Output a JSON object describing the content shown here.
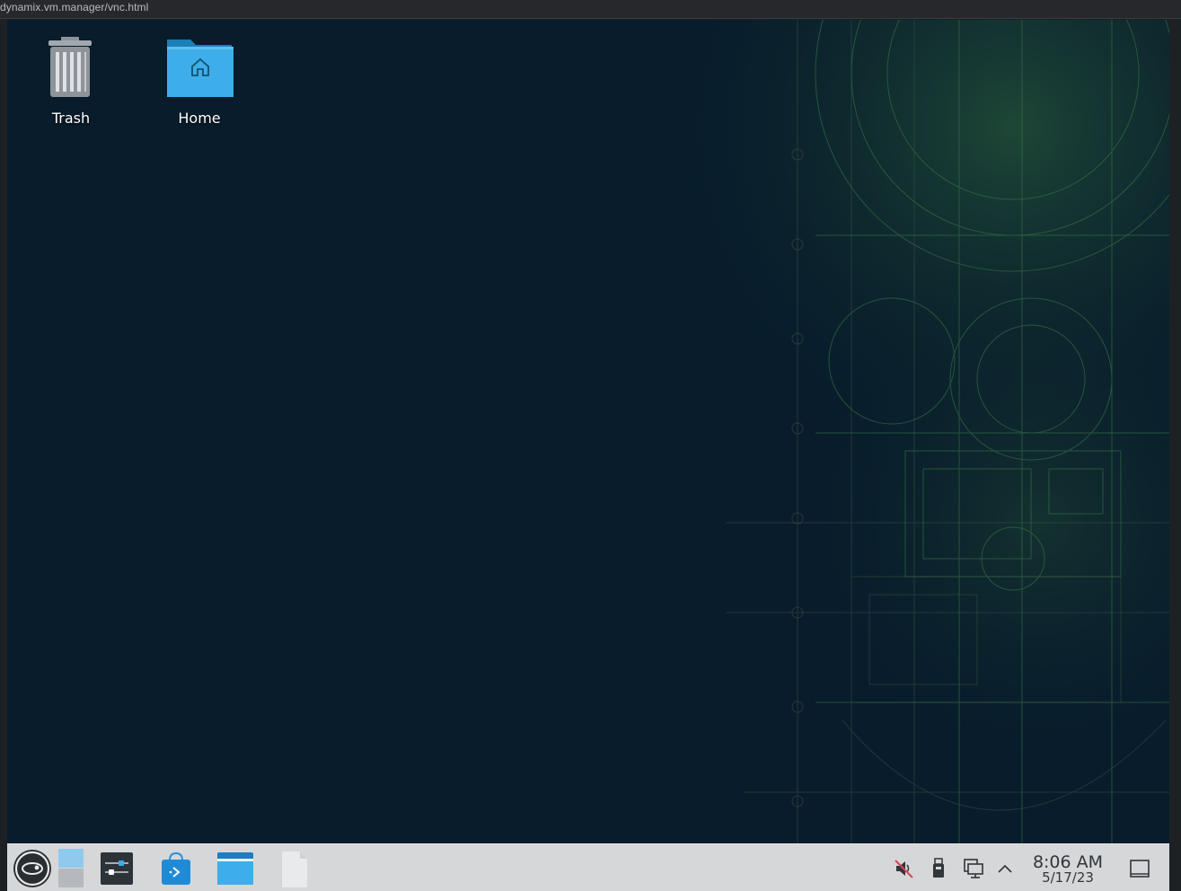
{
  "browser": {
    "url": "dynamix.vm.manager/vnc.html"
  },
  "desktop": {
    "icons": [
      {
        "label": "Trash",
        "icon": "trash-icon"
      },
      {
        "label": "Home",
        "icon": "home-folder-icon"
      }
    ]
  },
  "taskbar": {
    "launchers": [
      {
        "name": "application-launcher",
        "icon": "opensuse-logo-icon"
      },
      {
        "name": "pager",
        "icon": "virtual-desktop-pager-icon"
      },
      {
        "name": "system-settings",
        "icon": "settings-sliders-icon"
      },
      {
        "name": "discover",
        "icon": "software-store-icon"
      },
      {
        "name": "dolphin",
        "icon": "file-manager-icon"
      },
      {
        "name": "text-document",
        "icon": "document-icon"
      }
    ],
    "tray": [
      {
        "name": "volume",
        "icon": "volume-muted-icon"
      },
      {
        "name": "usb-devices",
        "icon": "usb-icon"
      },
      {
        "name": "network",
        "icon": "network-wired-icon"
      },
      {
        "name": "expand",
        "icon": "chevron-up-icon"
      }
    ],
    "clock": {
      "time": "8:06 AM",
      "date": "5/17/23"
    },
    "show_desktop": {
      "icon": "show-desktop-icon"
    }
  },
  "colors": {
    "desktop_bg": "#081c2b",
    "taskbar_bg": "#d5d7d9",
    "folder_blue": "#3daee9",
    "wallpaper_green": "#3e8a4a"
  }
}
